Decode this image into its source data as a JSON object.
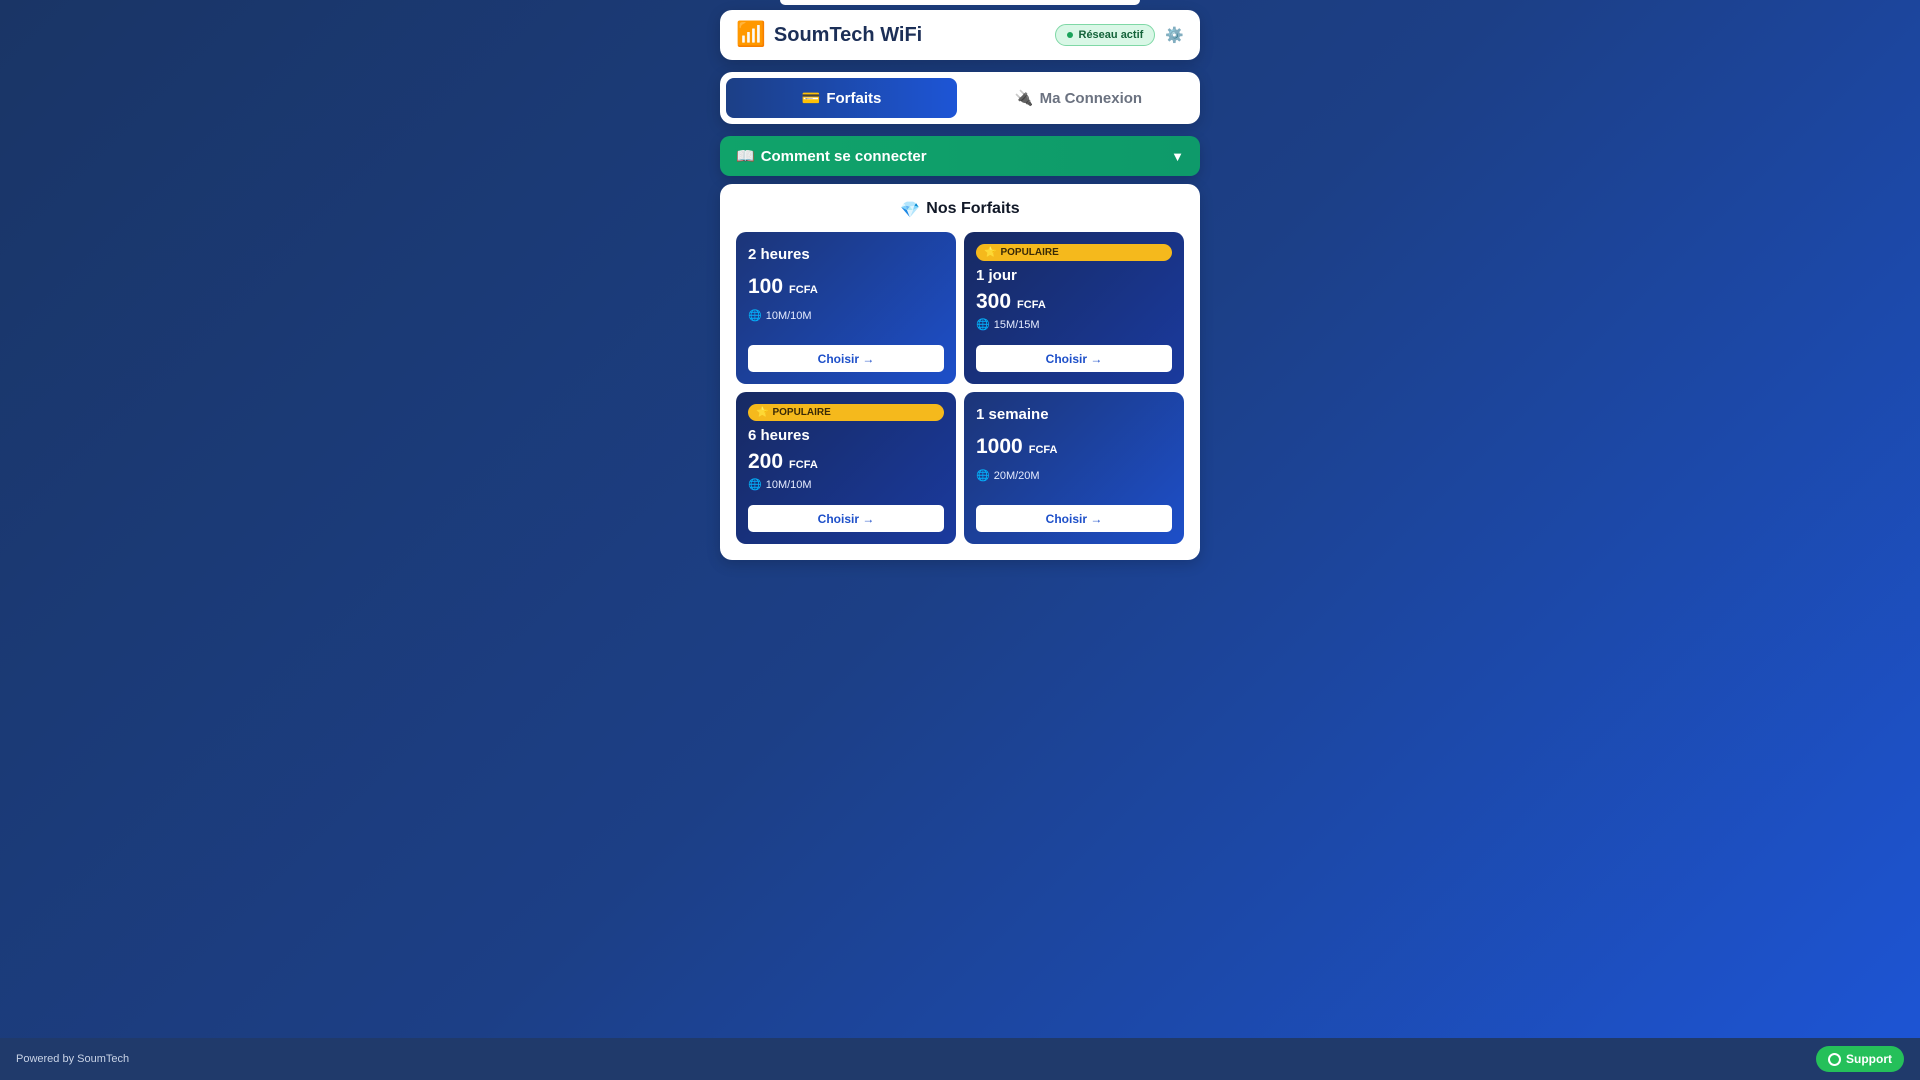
{
  "header": {
    "brand_icon": "📶",
    "title": "SoumTech WiFi",
    "status_label": "Réseau actif",
    "settings_icon": "⚙️"
  },
  "tabs": [
    {
      "icon": "💳",
      "label": "Forfaits",
      "active": true
    },
    {
      "icon": "🔌",
      "label": "Ma Connexion",
      "active": false
    }
  ],
  "guide": {
    "icon": "📖",
    "label": "Comment se connecter",
    "chevron": "▼"
  },
  "plans": {
    "title_icon": "💎",
    "title": "Nos Forfaits",
    "badge_icon": "⭐",
    "badge_label": "POPULAIRE",
    "speed_icon": "🌐",
    "button_label": "Choisir →",
    "items": [
      {
        "name": "2 heures",
        "price": "100",
        "currency": "FCFA",
        "speed": "10M/10M",
        "popular": false
      },
      {
        "name": "1 jour",
        "price": "300",
        "currency": "FCFA",
        "speed": "15M/15M",
        "popular": true
      },
      {
        "name": "6 heures",
        "price": "200",
        "currency": "FCFA",
        "speed": "10M/10M",
        "popular": true
      },
      {
        "name": "1 semaine",
        "price": "1000",
        "currency": "FCFA",
        "speed": "20M/20M",
        "popular": false
      }
    ]
  },
  "footer": {
    "powered": "Powered by SoumTech",
    "support_label": "Support"
  },
  "colors": {
    "accent": "#1d4fc9",
    "success": "#10a36a",
    "badge": "#f5b91c",
    "support": "#25c05a"
  }
}
